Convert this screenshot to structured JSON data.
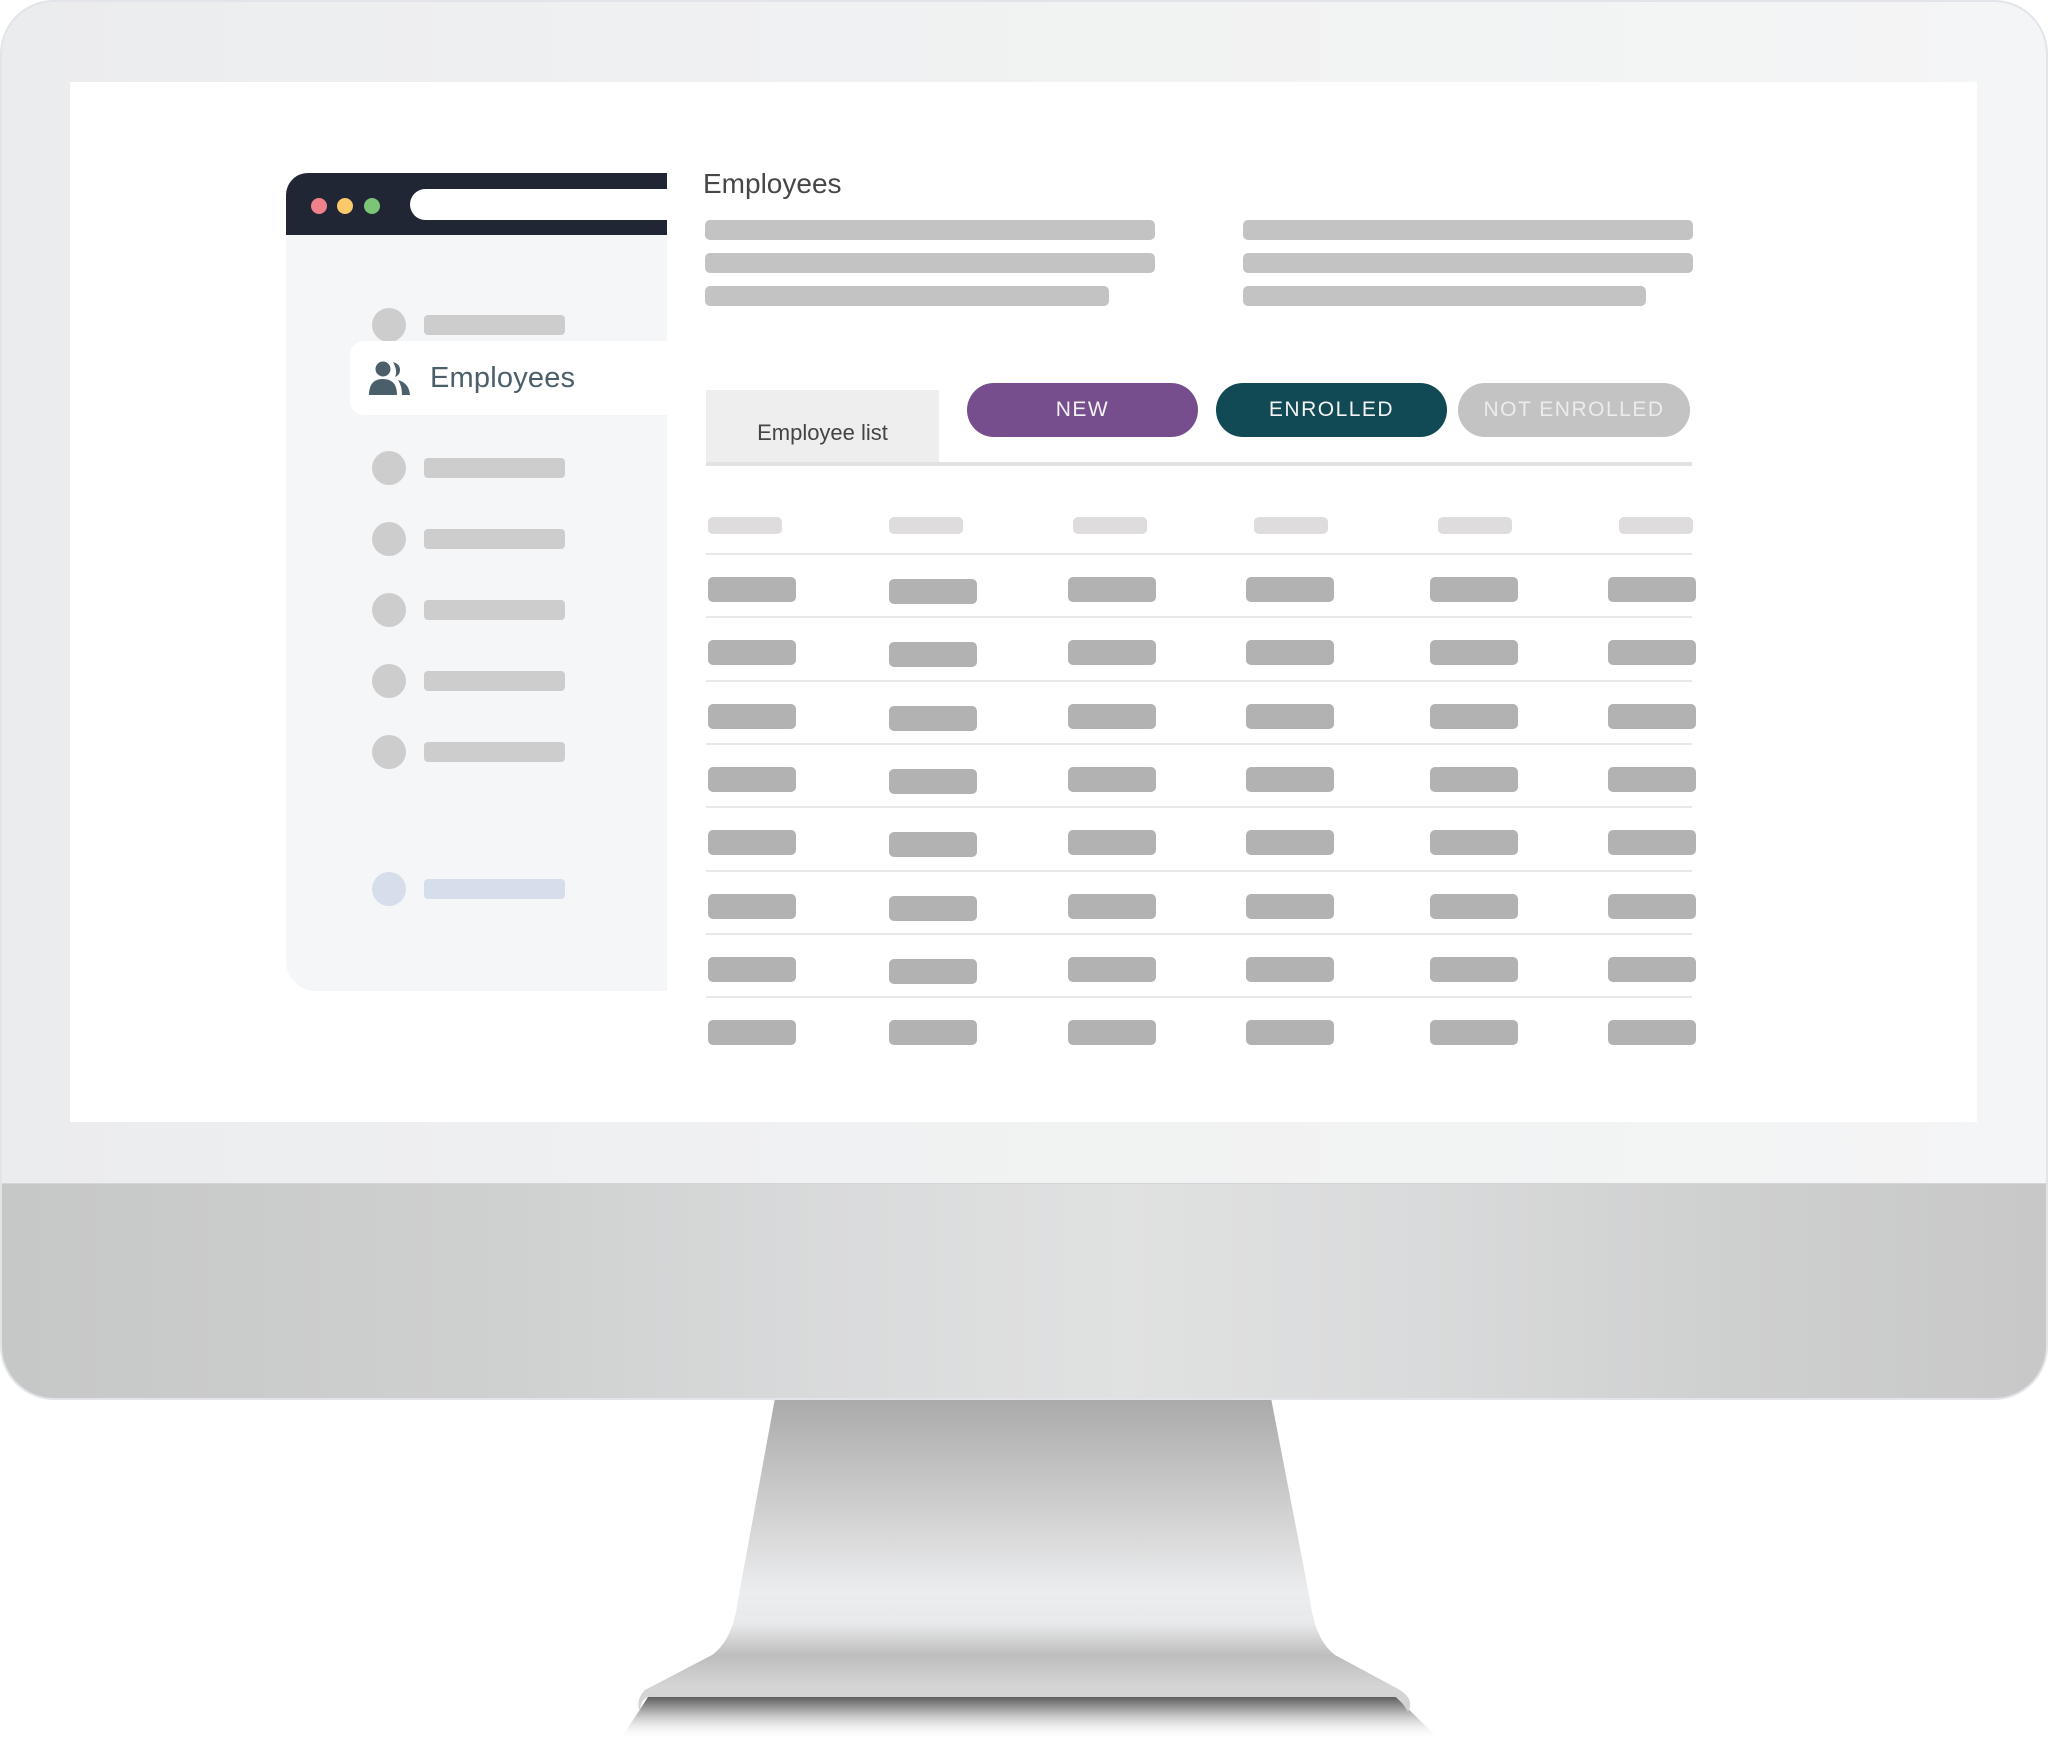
{
  "window": {
    "controls": [
      "close-dot",
      "minimize-dot",
      "maximize-dot"
    ],
    "colors": {
      "titlebar": "#212634",
      "close": "#f0808c",
      "minimize": "#fbc96a",
      "maximize": "#7cc576"
    }
  },
  "sidebar": {
    "items": [
      {
        "type": "placeholder"
      },
      {
        "type": "selected",
        "icon": "users-icon",
        "label": "Employees"
      },
      {
        "type": "placeholder"
      },
      {
        "type": "placeholder"
      },
      {
        "type": "placeholder"
      },
      {
        "type": "placeholder"
      },
      {
        "type": "placeholder"
      },
      {
        "type": "placeholder-muted"
      }
    ],
    "selected_label": "Employees",
    "icon_color": "#4b5f6a"
  },
  "main": {
    "title": "Employees",
    "description_placeholders": {
      "columns": 2,
      "lines_per_column": 3
    },
    "tabs": [
      {
        "label": "Employee list",
        "active": true
      }
    ],
    "filters": [
      {
        "label": "NEW",
        "color": "#774e8d"
      },
      {
        "label": "ENROLLED",
        "color": "#114a54"
      },
      {
        "label": "NOT ENROLLED",
        "color": "#c4c3c4"
      }
    ],
    "table": {
      "columns": 6,
      "rows": 8,
      "content": "placeholder"
    }
  }
}
